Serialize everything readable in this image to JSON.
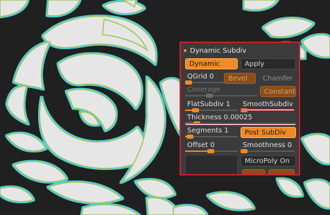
{
  "panel": {
    "title": "Dynamic Subdiv",
    "dynamic_button": "Dynamic",
    "apply_button": "Apply",
    "qgrid": {
      "label": "QGrid 0",
      "value": 0
    },
    "bevel_button": "Bevel",
    "chamfer_button": "Chamfer",
    "coverage": {
      "label": "Coverage",
      "value": 0.5
    },
    "constant_button": "Constant",
    "flatsubdiv": {
      "label": "FlatSubdiv 1",
      "value": 1
    },
    "smoothsubdiv": {
      "label": "SmoothSubdiv",
      "value": 0
    },
    "thickness": {
      "label": "Thickness 0.00025",
      "value": 0.00025
    },
    "segments": {
      "label": "Segments 1",
      "value": 1
    },
    "post_subdiv_button": "Post SubDiv",
    "offset": {
      "label": "Offset 0",
      "value": 0
    },
    "smoothness": {
      "label": "Smoothness 0",
      "value": 0
    },
    "micropoly_button": "MicroPoly On"
  },
  "colors": {
    "accent": "#f08a24",
    "panel_border": "#c8202a",
    "panel_bg": "#3b3b3b",
    "viewport_bg": "#202020"
  }
}
